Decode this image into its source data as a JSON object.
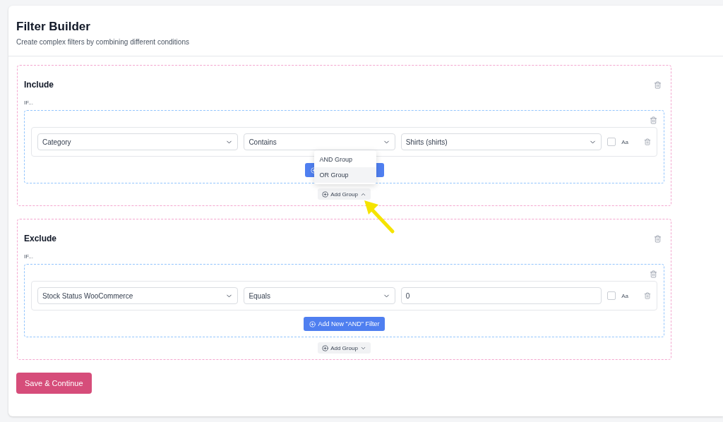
{
  "header": {
    "title": "Filter Builder",
    "subtitle": "Create complex filters by combining different conditions"
  },
  "sections": [
    {
      "title": "Include",
      "if_label": "IF...",
      "groups": [
        {
          "filters": [
            {
              "field": "Category",
              "operator": "Contains",
              "value": {
                "kind": "select",
                "text": "Shirts (shirts)"
              },
              "case_sensitive": false,
              "case_label": "Aa"
            }
          ]
        }
      ],
      "add_group": {
        "label": "Add Group",
        "open": true,
        "menu": [
          {
            "label": "AND Group",
            "selected": false
          },
          {
            "label": "OR Group",
            "selected": true
          }
        ]
      }
    },
    {
      "title": "Exclude",
      "if_label": "IF...",
      "groups": [
        {
          "filters": [
            {
              "field": "Stock Status WooCommerce",
              "operator": "Equals",
              "value": {
                "kind": "input",
                "text": "0"
              },
              "case_sensitive": false,
              "case_label": "Aa"
            }
          ],
          "add_filter_label": "Add New \"AND\" Filter"
        }
      ],
      "add_group": {
        "label": "Add Group",
        "open": false
      }
    }
  ],
  "save_button": "Save & Continue"
}
